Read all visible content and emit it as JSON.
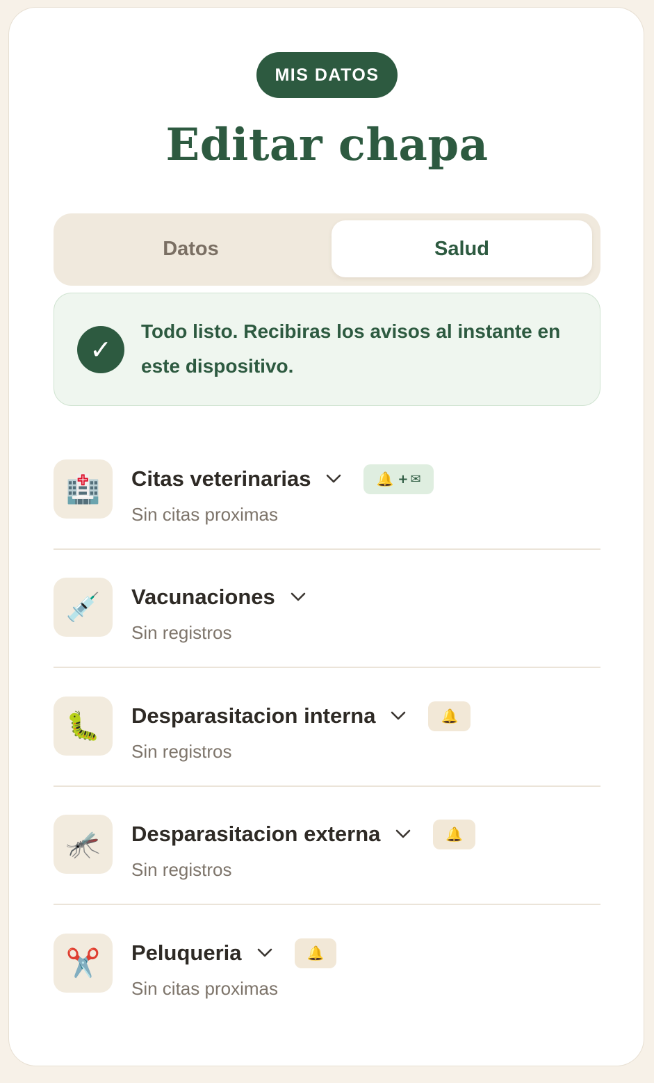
{
  "header": {
    "badge": "MIS DATOS",
    "title": "Editar chapa"
  },
  "tabs": [
    {
      "label": "Datos",
      "active": false
    },
    {
      "label": "Salud",
      "active": true
    }
  ],
  "notice": {
    "icon": "check-icon",
    "text": "Todo listo. Recibiras los avisos al instante en este dispositivo."
  },
  "sections": [
    {
      "title": "Citas veterinarias",
      "subtitle": "Sin citas proximas",
      "icon": "🏥",
      "icon_name": "hospital-icon",
      "alert": "bell+mail"
    },
    {
      "title": "Vacunaciones",
      "subtitle": "Sin registros",
      "icon": "💉",
      "icon_name": "syringe-icon",
      "alert": "none"
    },
    {
      "title": "Desparasitacion interna",
      "subtitle": "Sin registros",
      "icon": "🐛",
      "icon_name": "caterpillar-icon",
      "alert": "bell"
    },
    {
      "title": "Desparasitacion externa",
      "subtitle": "Sin registros",
      "icon": "🦟",
      "icon_name": "mosquito-icon",
      "alert": "bell"
    },
    {
      "title": "Peluqueria",
      "subtitle": "Sin citas proximas",
      "icon": "✂️",
      "icon_name": "scissors-icon",
      "alert": "bell"
    }
  ],
  "colors": {
    "brand": "#2d5a40",
    "page_bg": "#f7f1e8",
    "notice_bg": "#eff6ef",
    "tab_bg": "#f0e9dd",
    "bell": "#c89000"
  }
}
